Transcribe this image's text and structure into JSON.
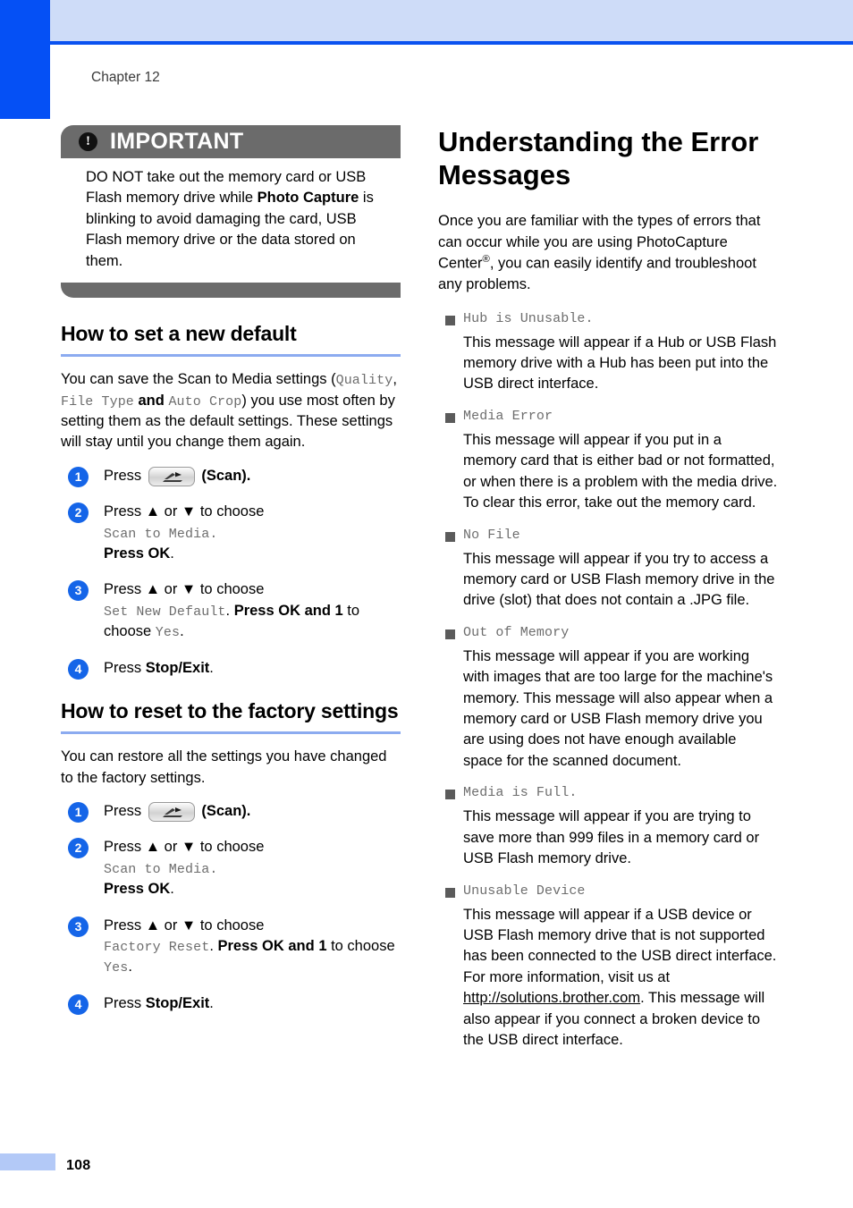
{
  "page": {
    "chapter_label": "Chapter 12",
    "page_number": "108",
    "accent_blue": "#0550f5",
    "rule_blue": "#8cabf0",
    "callout_gray": "#6b6b6b"
  },
  "callout": {
    "icon": "exclamation-icon",
    "glyph": "!",
    "title": "IMPORTANT",
    "text_1": "DO NOT take out the memory card or USB Flash memory drive while ",
    "text_bold": "Photo Capture",
    "text_2": " is blinking to avoid damaging the card, USB Flash memory drive or the data stored on them."
  },
  "left_column": {
    "sections": [
      {
        "title": "How to set a new default",
        "intro_1": "You can save the Scan to Media settings (",
        "intro_mono_1": "Quality",
        "intro_sep_1": ", ",
        "intro_mono_2": "File Type",
        "intro_mid": " and ",
        "intro_mono_3": "Auto Crop",
        "intro_2": ") you use most often by setting them as the default settings. These settings will stay until you change them again.",
        "steps": [
          {
            "num": "1",
            "press_label": "Press",
            "key_icon": "scan-key-icon",
            "key_caption": "(Scan).",
            "type": "press-key"
          },
          {
            "num": "2",
            "line_1": "Press ▲ or ▼ to choose",
            "mono_1": "Scan to Media.",
            "line_2_bold_prefix": "Press ",
            "line_2_bold": "OK",
            "line_2_suffix": ".",
            "type": "choose"
          },
          {
            "num": "3",
            "line_1": "Press ▲ or ▼ to choose",
            "mono_1": "Set New Default",
            "after_mono": ". ",
            "bold_press": "Press ",
            "bold_ok": "OK",
            "and_text": " and ",
            "bold_one": "1",
            "tail": " to choose ",
            "mono_2": "Yes",
            "tail_end": ".",
            "type": "choose-confirm"
          },
          {
            "num": "4",
            "press_label": "Press ",
            "bold_label": "Stop/Exit",
            "tail": ".",
            "type": "simple"
          }
        ]
      },
      {
        "title": "How to reset to the factory settings",
        "intro_plain": "You can restore all the settings you have changed to the factory settings.",
        "steps": [
          {
            "num": "1",
            "press_label": "Press",
            "key_icon": "scan-key-icon",
            "key_caption": "(Scan).",
            "type": "press-key"
          },
          {
            "num": "2",
            "line_1": "Press ▲ or ▼ to choose",
            "mono_1": "Scan to Media.",
            "line_2_bold_prefix": "Press ",
            "line_2_bold": "OK",
            "line_2_suffix": ".",
            "type": "choose"
          },
          {
            "num": "3",
            "line_1": "Press ▲ or ▼ to choose",
            "mono_1": "Factory Reset",
            "after_mono": ". ",
            "bold_press": "Press ",
            "bold_ok": "OK",
            "and_text": " and ",
            "bold_one": "1",
            "tail": " to choose ",
            "mono_2": "Yes",
            "tail_end": ".",
            "type": "choose-confirm"
          },
          {
            "num": "4",
            "press_label": "Press ",
            "bold_label": "Stop/Exit",
            "tail": ".",
            "type": "simple"
          }
        ]
      }
    ]
  },
  "right_column": {
    "title": "Understanding the Error Messages",
    "intro_1": "Once you are familiar with the types of errors that can occur while you are using PhotoCapture Center",
    "intro_sup": "®",
    "intro_2": ", you can easily identify and troubleshoot any problems.",
    "errors": [
      {
        "name": "Hub is Unusable.",
        "description": "This message will appear if a Hub or USB Flash memory drive with a Hub has been put into the USB direct interface."
      },
      {
        "name": "Media Error",
        "description": "This message will appear if you put in a memory card that is either bad or not formatted, or when there is a problem with the media drive. To clear this error, take out the memory card."
      },
      {
        "name": "No File",
        "description": "This message will appear if you try to access a memory card or USB Flash memory drive in the drive (slot) that does not contain a .JPG file."
      },
      {
        "name": "Out of Memory",
        "description": "This message will appear if you are working with images that are too large for the machine's memory. This message will also appear when a memory card or USB Flash memory drive you are using does not have enough available space for the scanned document."
      },
      {
        "name": "Media is Full.",
        "description": "This message will appear if you are trying to save more than 999 files in a memory card or USB Flash memory drive."
      },
      {
        "name": "Unusable Device",
        "description_1": "This message will appear if a USB device or USB Flash memory drive that is not supported has been connected to the USB direct interface. For more information, visit us at ",
        "link": "http://solutions.brother.com",
        "description_2": ". This message will also appear if you connect a broken device to the USB direct interface."
      }
    ]
  }
}
